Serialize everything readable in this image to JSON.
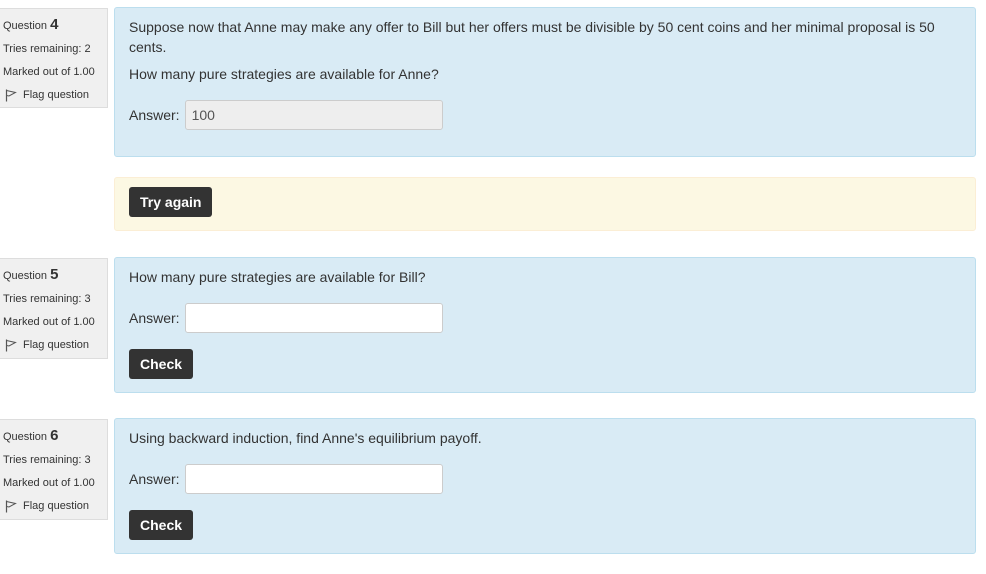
{
  "questions": [
    {
      "label": "Question",
      "number": "4",
      "tries": "Tries remaining: 2",
      "marked": "Marked out of 1.00",
      "flag": "Flag question",
      "text": [
        "Suppose now that Anne may make any offer to Bill but her offers must be divisible by 50 cent coins and her minimal proposal is 50 cents.",
        "How many pure strategies are available for Anne?"
      ],
      "answer_label": "Answer:",
      "answer_value": "100",
      "feedback_button": "Try again"
    },
    {
      "label": "Question",
      "number": "5",
      "tries": "Tries remaining: 3",
      "marked": "Marked out of 1.00",
      "flag": "Flag question",
      "text": [
        "How many pure strategies are available for Bill?"
      ],
      "answer_label": "Answer:",
      "answer_value": "",
      "button": "Check"
    },
    {
      "label": "Question",
      "number": "6",
      "tries": "Tries remaining: 3",
      "marked": "Marked out of 1.00",
      "flag": "Flag question",
      "text": [
        "Using backward induction, find Anne's equilibrium payoff."
      ],
      "answer_label": "Answer:",
      "answer_value": "",
      "button": "Check"
    }
  ],
  "icons": {
    "flag": "flag-icon"
  }
}
